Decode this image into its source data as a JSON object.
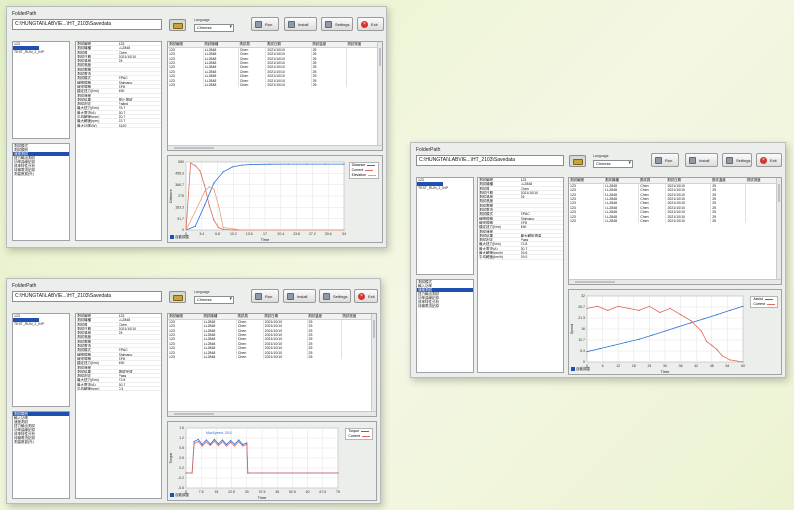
{
  "colors": {
    "selection": "#1f4fb0",
    "series_blue": "#2e6fd6",
    "series_red": "#e06a5a",
    "series_orange": "#e8a070",
    "exit_red": "#d8312a"
  },
  "windows": [
    {
      "id": "top-left",
      "folder_label": "FolderPath",
      "path": "C:\\HUNGTAI\\LABVIE...\\HT_2103\\Savedata",
      "language_label": "Language",
      "language_value": "Chinese",
      "buttons": {
        "run": "Run",
        "install": "Install",
        "settings": "Settings",
        "exit": "Exit"
      },
      "file_list": [
        "123",
        "",
        ""
      ],
      "file_list_selected": "",
      "file_list_sub": "TEST_RUN_2_INP",
      "info_rows": [
        [
          "測試編號",
          "123"
        ],
        [
          "測試機種",
          "LL2848"
        ],
        [
          "測試員",
          "Chen"
        ],
        [
          "測試日期",
          "2021/10/10"
        ],
        [
          "測試溫度",
          "25"
        ],
        [
          "測試濕度",
          ""
        ],
        [
          "測試電壓",
          ""
        ],
        [
          "測試電流",
          ""
        ],
        [
          "測試模式",
          "EPAC"
        ],
        [
          "線圈規格",
          "Shimano"
        ],
        [
          "線徑規格",
          "EF8"
        ],
        [
          "額定扭力(Nm)",
          "450"
        ],
        [
          "測試速度",
          ""
        ],
        [
          "測試結果",
          "停止測試"
        ],
        [
          "測試判定",
          "Failed"
        ],
        [
          "最大扭力(Nm)",
          "76.7"
        ],
        [
          "最大電流(A)",
          "30.7"
        ],
        [
          "平均轉速(rpm)",
          "20.7"
        ],
        [
          "最大轉速(rpm)",
          "22.7"
        ],
        [
          "最大功率(W)",
          "3120"
        ]
      ],
      "cat_list": [
        "測試模式",
        "測試類別",
        "速度測試",
        "扭力輸出測試",
        "功率曲線記錄",
        "效率特性分析",
        "待機電流記錄",
        "測量數據(外)"
      ],
      "cat_selected": "速度測試",
      "table_headers": [
        "測試編號",
        "測試機種",
        "測試員",
        "測試日期",
        "測試溫度",
        "測試濕度"
      ],
      "table_rows": [
        [
          "123",
          "LL2848",
          "Chen",
          "2021/10/10",
          "25",
          ""
        ],
        [
          "123",
          "LL2848",
          "Chen",
          "2021/10/10",
          "25",
          ""
        ],
        [
          "123",
          "LL2848",
          "Chen",
          "2021/10/10",
          "25",
          ""
        ],
        [
          "123",
          "LL2848",
          "Chen",
          "2021/10/10",
          "25",
          ""
        ],
        [
          "123",
          "LL2848",
          "Chen",
          "2021/10/10",
          "25",
          ""
        ],
        [
          "123",
          "LL2848",
          "Chen",
          "2021/10/10",
          "25",
          ""
        ],
        [
          "123",
          "LL2848",
          "Chen",
          "2021/10/10",
          "25",
          ""
        ],
        [
          "123",
          "LL2848",
          "Chen",
          "2021/10/10",
          "25",
          ""
        ],
        [
          "123",
          "LL2848",
          "Chen",
          "2021/10/10",
          "25",
          ""
        ]
      ],
      "legend": [
        "Distance",
        "Current",
        "Elevation"
      ],
      "autoscale_label": "自動調整",
      "xlabel": "Time",
      "ylabel": "Distance"
    },
    {
      "id": "bottom-left",
      "folder_label": "FolderPath",
      "path": "C:\\HUNGTAI\\LABVIE...\\HT_2103\\Savedata",
      "language_label": "Language",
      "language_value": "Chinese",
      "buttons": {
        "run": "Run",
        "install": "Install",
        "settings": "Settings",
        "exit": "Exit"
      },
      "file_list": [
        "123"
      ],
      "file_list_sub": "TEST_RUN_2_INP",
      "info_rows": [
        [
          "測試編號",
          "123"
        ],
        [
          "測試機種",
          "LL2848"
        ],
        [
          "測試員",
          "Chen"
        ],
        [
          "測試日期",
          "2021/10/10"
        ],
        [
          "測試溫度",
          "25"
        ],
        [
          "測試濕度",
          ""
        ],
        [
          "測試電壓",
          ""
        ],
        [
          "測試電流",
          ""
        ],
        [
          "測試模式",
          "EPAC"
        ],
        [
          "線圈規格",
          "Shimano"
        ],
        [
          "線徑規格",
          "EF8"
        ],
        [
          "額定扭力(Nm)",
          "450"
        ],
        [
          "測試速度",
          ""
        ],
        [
          "測試結果",
          "測試完成"
        ],
        [
          "測試判定",
          "Pass"
        ],
        [
          "最大扭力(Nm)",
          "72.8"
        ],
        [
          "最大電流(A)",
          "30.7"
        ],
        [
          "平均轉速(rpm)",
          "0.3"
        ]
      ],
      "cat_list": [
        "測試類別",
        "輸入功率",
        "速度測試",
        "扭力輸出測試",
        "功率曲線記錄",
        "效率特性分析",
        "待機電流記錄",
        "測量數據(外)"
      ],
      "cat_selected": "測試類別",
      "table_headers": [
        "測試編號",
        "測試機種",
        "測試員",
        "測試日期",
        "測試溫度",
        "測試濕度"
      ],
      "table_rows": [
        [
          "123",
          "LL2848",
          "Chen",
          "2021/10/10",
          "25",
          ""
        ],
        [
          "123",
          "LL2848",
          "Chen",
          "2021/10/10",
          "25",
          ""
        ],
        [
          "123",
          "LL2848",
          "Chen",
          "2021/10/10",
          "25",
          ""
        ],
        [
          "123",
          "LL2848",
          "Chen",
          "2021/10/10",
          "25",
          ""
        ],
        [
          "123",
          "LL2848",
          "Chen",
          "2021/10/10",
          "25",
          ""
        ],
        [
          "123",
          "LL2848",
          "Chen",
          "2021/10/10",
          "25",
          ""
        ],
        [
          "123",
          "LL2848",
          "Chen",
          "2021/10/10",
          "25",
          ""
        ],
        [
          "123",
          "LL2848",
          "Chen",
          "2021/10/10",
          "25",
          ""
        ],
        [
          "123",
          "LL2848",
          "Chen",
          "2021/10/10",
          "25",
          ""
        ]
      ],
      "legend": [
        "Torque",
        "Current"
      ],
      "autoscale_label": "自動調整",
      "chart_annotation": "MaxSpeed: 25.5",
      "xlabel": "Time",
      "ylabel": "Torque"
    },
    {
      "id": "right",
      "folder_label": "FolderPath",
      "path": "C:\\HUNGTAI\\LABVIE...\\HT_2103\\Savedata",
      "language_label": "Language",
      "language_value": "Chinese",
      "buttons": {
        "run": "Run",
        "install": "Install",
        "settings": "Settings",
        "exit": "Exit"
      },
      "file_list": [
        "123"
      ],
      "file_list_sub": "TEST_RUN_2_INP",
      "info_rows": [
        [
          "測試編號",
          "123"
        ],
        [
          "測試機種",
          "LL2848"
        ],
        [
          "測試員",
          "Chen"
        ],
        [
          "測試日期",
          "2021/10/10"
        ],
        [
          "測試溫度",
          "25"
        ],
        [
          "測試濕度",
          ""
        ],
        [
          "測試電壓",
          ""
        ],
        [
          "測試電流",
          ""
        ],
        [
          "測試模式",
          "EPAC"
        ],
        [
          "線圈規格",
          "Shimano"
        ],
        [
          "線徑規格",
          "EF8"
        ],
        [
          "額定扭力(Nm)",
          "450"
        ],
        [
          "測試速度",
          ""
        ],
        [
          "測試結果",
          "最大轉矩測量"
        ],
        [
          "測試判定",
          "Pass"
        ],
        [
          "最大扭力(Nm)",
          "72.8"
        ],
        [
          "最大電流(A)",
          "30.7"
        ],
        [
          "最大轉速(km/h)",
          "29.6"
        ],
        [
          "平均轉速(km/h)",
          "29.0"
        ]
      ],
      "cat_list": [
        "測試模式",
        "輸入功率",
        "速度測試",
        "扭力輸出測試",
        "功率曲線記錄",
        "效率特性分析",
        "待機電流記錄"
      ],
      "cat_selected": "速度測試",
      "table_headers": [
        "測試編號",
        "測試機種",
        "測試員",
        "測試日期",
        "測試溫度",
        "測試濕度"
      ],
      "table_rows": [
        [
          "123",
          "LL2848",
          "Chen",
          "2021/10/10",
          "25",
          ""
        ],
        [
          "123",
          "LL2848",
          "Chen",
          "2021/10/10",
          "25",
          ""
        ],
        [
          "123",
          "LL2848",
          "Chen",
          "2021/10/10",
          "25",
          ""
        ],
        [
          "123",
          "LL2848",
          "Chen",
          "2021/10/10",
          "25",
          ""
        ],
        [
          "123",
          "LL2848",
          "Chen",
          "2021/10/10",
          "25",
          ""
        ],
        [
          "123",
          "LL2848",
          "Chen",
          "2021/10/10",
          "25",
          ""
        ],
        [
          "123",
          "LL2848",
          "Chen",
          "2021/10/10",
          "25",
          ""
        ],
        [
          "123",
          "LL2848",
          "Chen",
          "2021/10/10",
          "25",
          ""
        ],
        [
          "123",
          "LL2848",
          "Chen",
          "2021/10/10",
          "25",
          ""
        ]
      ],
      "legend": [
        "Assist",
        "Current"
      ],
      "autoscale_label": "自動調整",
      "xlabel": "Time",
      "ylabel": "Speed"
    }
  ],
  "chart_data": [
    {
      "type": "line",
      "window": "top-left",
      "xlabel": "Time",
      "ylabel": "Distance",
      "xlim": [
        0,
        34
      ],
      "ylim": [
        0,
        550
      ],
      "series": [
        {
          "name": "Distance",
          "color": "#2e6fd6",
          "x": [
            0,
            2,
            4,
            6,
            8,
            10,
            12,
            14,
            18,
            22,
            26,
            30,
            34
          ],
          "y": [
            0,
            30,
            200,
            380,
            470,
            510,
            525,
            530,
            532,
            533,
            533,
            533,
            533
          ]
        },
        {
          "name": "Current",
          "color": "#e06a5a",
          "x": [
            0,
            1,
            2,
            3,
            4,
            5,
            6,
            7,
            8,
            10,
            14,
            20,
            34
          ],
          "y": [
            0,
            540,
            520,
            480,
            360,
            200,
            80,
            20,
            5,
            0,
            0,
            0,
            0
          ]
        },
        {
          "name": "Elevation",
          "color": "#e8a070",
          "x": [
            0,
            2,
            4,
            5,
            6,
            7,
            8,
            12,
            34
          ],
          "y": [
            0,
            150,
            310,
            350,
            330,
            200,
            20,
            0,
            0
          ]
        }
      ]
    },
    {
      "type": "line",
      "window": "bottom-left",
      "xlabel": "Time",
      "ylabel": "Torque",
      "xlim": [
        0,
        75
      ],
      "ylim": [
        -0.5,
        1.5
      ],
      "series": [
        {
          "name": "Torque",
          "color": "#2e6fd6",
          "x": [
            0,
            3,
            4,
            6,
            8,
            10,
            12,
            14,
            16,
            18,
            20,
            22,
            24,
            26,
            28,
            30,
            30.5,
            75
          ],
          "y": [
            0,
            0,
            1.05,
            1.12,
            0.95,
            1.1,
            0.96,
            1.12,
            0.97,
            1.1,
            0.95,
            1.08,
            0.96,
            1.1,
            0.95,
            1.0,
            0,
            0
          ]
        },
        {
          "name": "Current",
          "color": "#e06a5a",
          "x": [
            0,
            3,
            4,
            6,
            8,
            10,
            12,
            14,
            16,
            18,
            20,
            22,
            24,
            26,
            28,
            30,
            30.5,
            75
          ],
          "y": [
            0,
            0,
            0.98,
            1.05,
            0.9,
            1.03,
            0.92,
            1.06,
            0.91,
            1.04,
            0.9,
            1.02,
            0.9,
            1.04,
            0.9,
            0.95,
            0,
            0
          ]
        }
      ]
    },
    {
      "type": "line",
      "window": "right",
      "xlabel": "Time",
      "ylabel": "Speed",
      "xlim": [
        0,
        60
      ],
      "ylim": [
        0,
        32
      ],
      "series": [
        {
          "name": "Assist",
          "color": "#2e6fd6",
          "x": [
            0,
            5,
            10,
            15,
            20,
            25,
            30,
            35,
            40,
            45,
            50,
            55,
            60
          ],
          "y": [
            5,
            6.5,
            8,
            9.5,
            11,
            13,
            15,
            17,
            19,
            21,
            23,
            25,
            27
          ]
        },
        {
          "name": "Current",
          "color": "#e06a5a",
          "x": [
            0,
            4,
            8,
            12,
            16,
            20,
            24,
            28,
            32,
            36,
            40,
            44,
            46,
            48,
            50,
            52,
            55,
            60
          ],
          "y": [
            26,
            27,
            25,
            27,
            26,
            25,
            27,
            24,
            26,
            23,
            20,
            15,
            10,
            8,
            6,
            3,
            1,
            0
          ]
        }
      ]
    }
  ]
}
